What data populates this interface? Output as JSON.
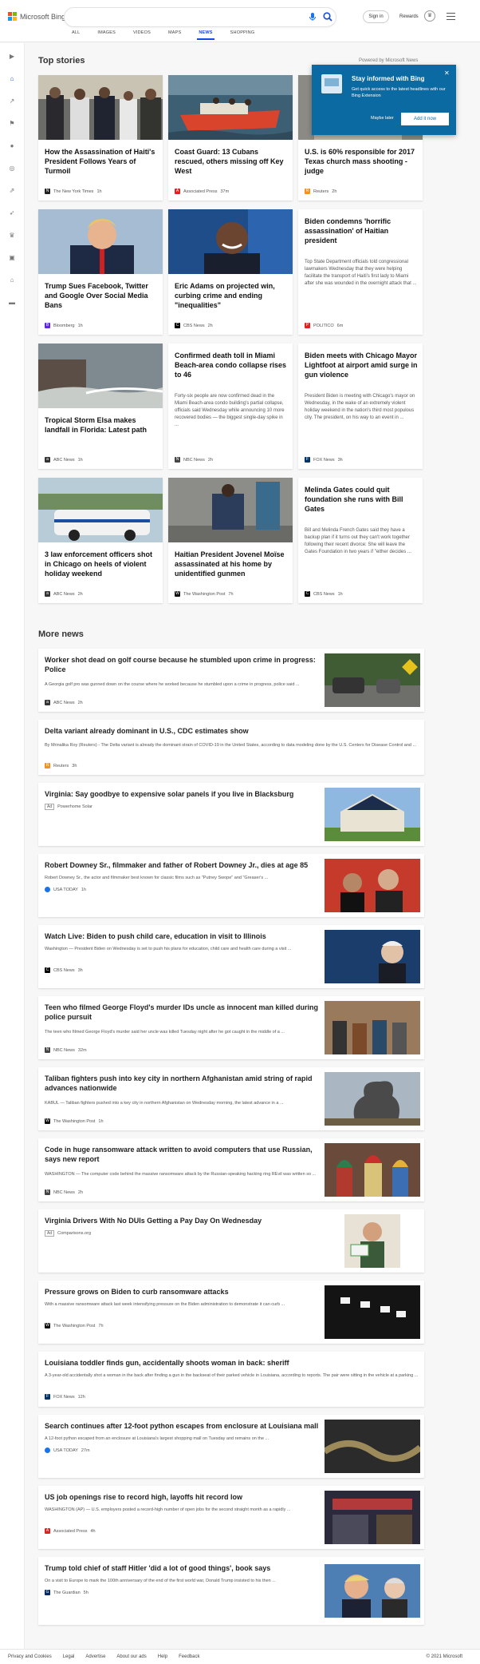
{
  "header": {
    "logo_text": "Microsoft Bing",
    "search_value": "",
    "signin_label": "Sign in",
    "rewards_label": "Rewards",
    "nav": [
      "ALL",
      "IMAGES",
      "VIDEOS",
      "MAPS",
      "NEWS",
      "SHOPPING"
    ],
    "active_nav": "NEWS",
    "colors": {
      "accent": "#174ae4",
      "logo_red": "#f25022",
      "logo_green": "#7fba00",
      "logo_blue": "#00a4ef",
      "logo_yellow": "#ffb900"
    }
  },
  "sidebar": {
    "icons": [
      "chevron-right-icon",
      "home-icon",
      "trending-icon",
      "flag-icon",
      "location-pin-icon",
      "globe-icon",
      "finance-icon",
      "rocket-icon",
      "trophy-icon",
      "film-icon",
      "bank-icon",
      "car-icon"
    ]
  },
  "top_stories": {
    "title": "Top stories",
    "powered_by": "Powered by Microsoft News",
    "cards": [
      {
        "title": "How the Assassination of Haiti's President Follows Years of Turmoil",
        "source": "The New York Times",
        "time": "1h",
        "snippet": "",
        "image": "people-crowd-photo"
      },
      {
        "title": "Coast Guard: 13 Cubans rescued, others missing off Key West",
        "source": "Associated Press",
        "time": "37m",
        "snippet": "",
        "image": "rescue-boat-photo"
      },
      {
        "title": "U.S. is 60% responsible for 2017 Texas church mass shooting -judge",
        "source": "Reuters",
        "time": "2h",
        "snippet": "",
        "image": "church-photo"
      },
      {
        "title": "Trump Sues Facebook, Twitter and Google Over Social Media Bans",
        "source": "Bloomberg",
        "time": "1h",
        "snippet": "",
        "image": "trump-photo"
      },
      {
        "title": "Eric Adams on projected win, curbing crime and ending \"inequalities\"",
        "source": "CBS News",
        "time": "2h",
        "snippet": "",
        "image": "eric-adams-photo"
      },
      {
        "title": "Biden condemns 'horrific assassination' of Haitian president",
        "source": "POLITICO",
        "time": "6m",
        "snippet": "Top State Department officials told congressional lawmakers Wednesday that they were helping facilitate the transport of Haiti's first lady to Miami after she was wounded in the overnight attack that ...",
        "image": ""
      },
      {
        "title": "Tropical Storm Elsa makes landfall in Florida: Latest path",
        "source": "ABC News",
        "time": "1h",
        "snippet": "",
        "image": "storm-photo"
      },
      {
        "title": "Confirmed death toll in Miami Beach-area condo collapse rises to 46",
        "source": "NBC News",
        "time": "2h",
        "snippet": "Forty-six people are now confirmed dead in the Miami Beach-area condo building's partial collapse, officials said Wednesday while announcing 10 more recovered bodies — the biggest single-day spike in ...",
        "image": ""
      },
      {
        "title": "Biden meets with Chicago Mayor Lightfoot at airport amid surge in gun violence",
        "source": "FOX News",
        "time": "3h",
        "snippet": "President Biden is meeting with Chicago's mayor on Wednesday, in the wake of an extremely violent holiday weekend in the nation's third most populous city. The president, on his way to an event in ...",
        "image": ""
      },
      {
        "title": "3 law enforcement officers shot in Chicago on heels of violent holiday weekend",
        "source": "ABC News",
        "time": "2h",
        "snippet": "",
        "image": "police-car-photo"
      },
      {
        "title": "Haitian President Jovenel Moïse assassinated at his home by unidentified gunmen",
        "source": "The Washington Post",
        "time": "7h",
        "snippet": "",
        "image": "haiti-scene-photo"
      },
      {
        "title": "Melinda Gates could quit foundation she runs with Bill Gates",
        "source": "CBS News",
        "time": "1h",
        "snippet": "Bill and Melinda French Gates said they have a backup plan if it turns out they can't work together following their recent divorce: She will leave the Gates Foundation in two years if \"either decides ...",
        "image": ""
      }
    ]
  },
  "popup": {
    "title": "Stay informed with Bing",
    "text": "Get quick access to the latest headlines with our Bing Extension",
    "later_label": "Maybe later",
    "add_label": "Add it now"
  },
  "more_news": {
    "title": "More news",
    "items": [
      {
        "title": "Worker shot dead on golf course because he stumbled upon crime in progress: Police",
        "snippet": "A Georgia golf pro was gunned down on the course where he worked because he stumbled upon a crime in progress, police said ...",
        "source": "ABC News",
        "time": "2h",
        "ad": false,
        "image": "golf-course-photo"
      },
      {
        "title": "Delta variant already dominant in U.S., CDC estimates show",
        "snippet": "By Mrinalika Roy (Reuters) - The Delta variant is already the dominant strain of COVID-19 in the United States, according to data modeling done by the U.S. Centers for Disease Control and ...",
        "source": "Reuters",
        "time": "3h",
        "ad": false,
        "image": ""
      },
      {
        "title": "Virginia: Say goodbye to expensive solar panels if you live in Blacksburg",
        "snippet": "",
        "source": "Powerhome Solar",
        "time": "",
        "ad": true,
        "image": "solar-house-photo"
      },
      {
        "title": "Robert Downey Sr., filmmaker and father of Robert Downey Jr., dies at age 85",
        "snippet": "Robert Downey Sr., the actor and filmmaker best known for classic films such as \"Putney Swope\" and \"Greaser's ...",
        "source": "USA TODAY",
        "time": "1h",
        "ad": false,
        "image": "downey-photo"
      },
      {
        "title": "Watch Live: Biden to push child care, education in visit to Illinois",
        "snippet": "Washington — President Biden on Wednesday is set to push his plans for education, child care and health care during a visit ...",
        "source": "CBS News",
        "time": "3h",
        "ad": false,
        "image": "biden-photo"
      },
      {
        "title": "Teen who filmed George Floyd's murder IDs uncle as innocent man killed during police pursuit",
        "snippet": "The teen who filmed George Floyd's murder said her uncle was killed Tuesday night after he got caught in the middle of a ...",
        "source": "NBC News",
        "time": "32m",
        "ad": false,
        "image": "memorial-photo"
      },
      {
        "title": "Taliban fighters push into key city in northern Afghanistan amid string of rapid advances nationwide",
        "snippet": "KABUL — Taliban fighters pushed into a key city in northern Afghanistan on Wednesday morning, the latest advance in a ...",
        "source": "The Washington Post",
        "time": "1h",
        "ad": false,
        "image": "smoke-photo"
      },
      {
        "title": "Code in huge ransomware attack written to avoid computers that use Russian, says new report",
        "snippet": "WASHINGTON — The computer code behind the massive ransomware attack by the Russian-speaking hacking ring REvil was written so ...",
        "source": "NBC News",
        "time": "2h",
        "ad": false,
        "image": "kremlin-photo"
      },
      {
        "title": "Virginia Drivers With No DUIs Getting a Pay Day On Wednesday",
        "snippet": "",
        "source": "Comparisons.org",
        "time": "",
        "ad": true,
        "image": "man-card-photo"
      },
      {
        "title": "Pressure grows on Biden to curb ransomware attacks",
        "snippet": "With a massive ransomware attack last week intensifying pressure on the Biden administration to demonstrate it can curb ...",
        "source": "The Washington Post",
        "time": "7h",
        "ad": false,
        "image": "server-photo"
      },
      {
        "title": "Louisiana toddler finds gun, accidentally shoots woman in back: sheriff",
        "snippet": "A 3-year-old accidentally shot a woman in the back after finding a gun in the backseat of their parked vehicle in Louisiana, according to reports. The pair were sitting in the vehicle at a parking ...",
        "source": "FOX News",
        "time": "12h",
        "ad": false,
        "image": ""
      },
      {
        "title": "Search continues after 12-foot python escapes from enclosure at Louisiana mall",
        "snippet": "A 12-foot python escaped from an enclosure at Louisiana's largest shopping mall on Tuesday and remains on the ...",
        "source": "USA TODAY",
        "time": "27m",
        "ad": false,
        "image": "python-photo"
      },
      {
        "title": "US job openings rise to record high, layoffs hit record low",
        "snippet": "WASHINGTON (AP) — U.S. employers posted a record-high number of open jobs for the second straight month as a rapidly ...",
        "source": "Associated Press",
        "time": "4h",
        "ad": false,
        "image": "store-photo"
      },
      {
        "title": "Trump told chief of staff Hitler 'did a lot of good things', book says",
        "snippet": "On a visit to Europe to mark the 100th anniversary of the end of the first world war, Donald Trump insisted to his then ...",
        "source": "The Guardian",
        "time": "5h",
        "ad": false,
        "image": "trump-kelly-photo"
      }
    ]
  },
  "footer": {
    "links": [
      "Privacy and Cookies",
      "Legal",
      "Advertise",
      "About our ads",
      "Help",
      "Feedback"
    ],
    "copyright": "© 2021 Microsoft"
  }
}
